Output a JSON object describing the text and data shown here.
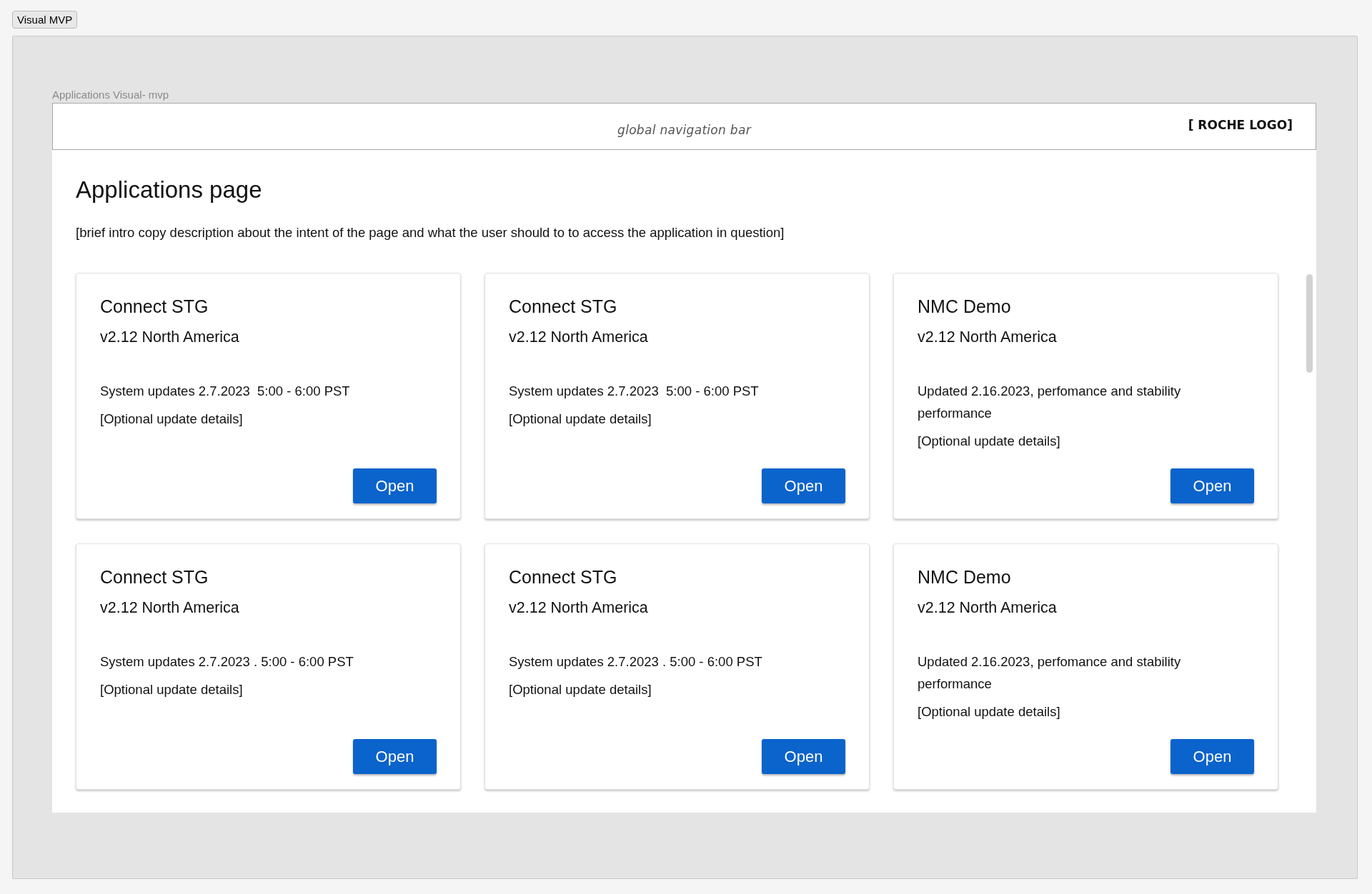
{
  "top_button": "Visual MVP",
  "frame_label": "Applications Visual- mvp",
  "nav_bar": {
    "caption": "global navigation bar",
    "logo": "[ ROCHE LOGO]"
  },
  "page": {
    "title": "Applications page",
    "intro": "[brief intro copy description about the intent of the page and what the user should to to access the application in question]"
  },
  "cards": [
    {
      "title": "Connect STG",
      "version": "v2.12 North America",
      "update": "System updates 2.7.2023  5:00 - 6:00 PST",
      "details": "[Optional update details]",
      "button": "Open"
    },
    {
      "title": "Connect STG",
      "version": "v2.12 North America",
      "update": "System updates 2.7.2023  5:00 - 6:00 PST",
      "details": "[Optional update details]",
      "button": "Open"
    },
    {
      "title": "NMC Demo",
      "version": "v2.12 North America",
      "update": "Updated 2.16.2023, perfomance and stability performance",
      "details": "[Optional update details]",
      "button": "Open"
    },
    {
      "title": "Connect STG",
      "version": "v2.12 North America",
      "update": "System updates 2.7.2023 . 5:00 - 6:00 PST",
      "details": "[Optional update details]",
      "button": "Open"
    },
    {
      "title": "Connect STG",
      "version": "v2.12 North America",
      "update": "System updates 2.7.2023 . 5:00 - 6:00 PST",
      "details": "[Optional update details]",
      "button": "Open"
    },
    {
      "title": "NMC Demo",
      "version": "v2.12 North America",
      "update": "Updated 2.16.2023, perfomance and stability performance",
      "details": "[Optional update details]",
      "button": "Open"
    }
  ]
}
